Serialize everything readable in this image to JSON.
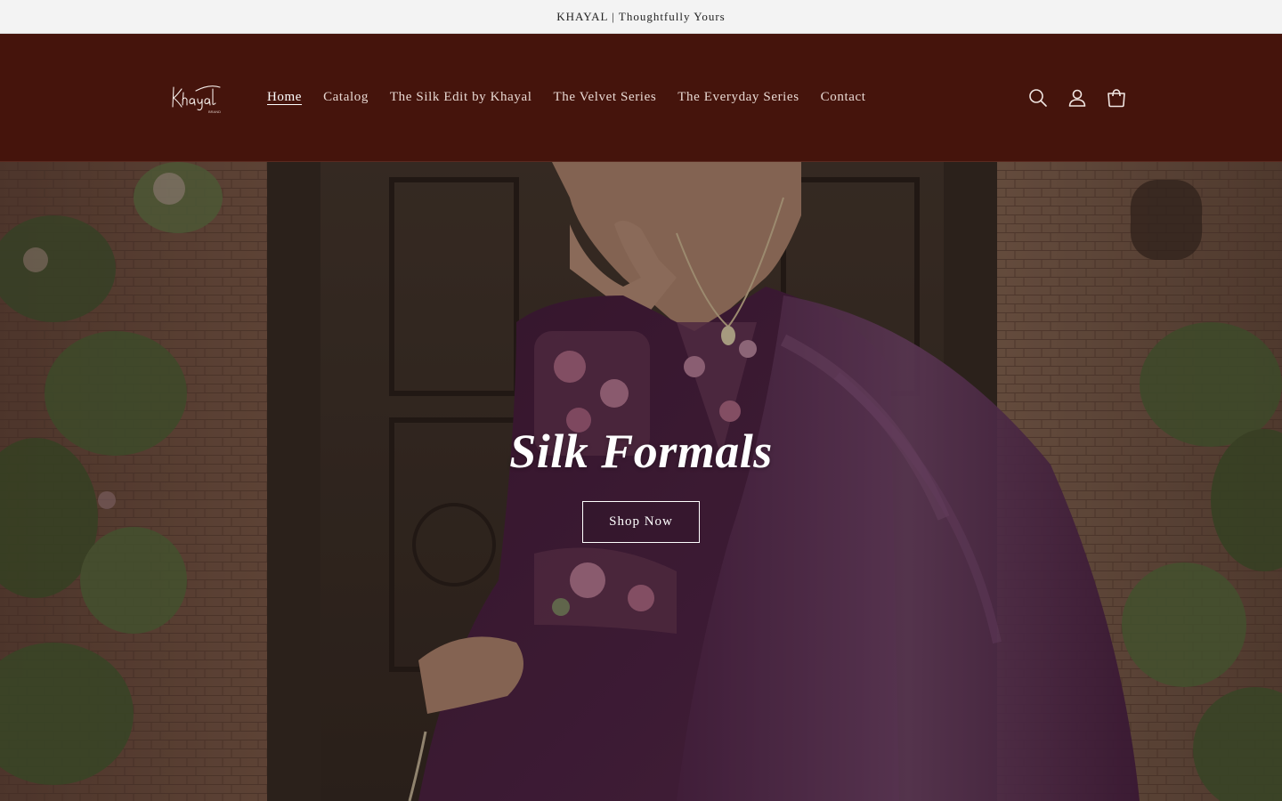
{
  "announcement": {
    "text": "KHAYAL | Thoughtfully Yours"
  },
  "header": {
    "logo_text": "Khayal",
    "nav": [
      {
        "label": "Home",
        "active": true
      },
      {
        "label": "Catalog",
        "active": false
      },
      {
        "label": "The Silk Edit by Khayal",
        "active": false
      },
      {
        "label": "The Velvet Series",
        "active": false
      },
      {
        "label": "The Everyday Series",
        "active": false
      },
      {
        "label": "Contact",
        "active": false
      }
    ],
    "icons": [
      "search-icon",
      "account-icon",
      "cart-icon"
    ]
  },
  "hero": {
    "title": "Silk Formals",
    "button_label": "Shop Now"
  },
  "colors": {
    "announcement_bg": "#f3f3f3",
    "header_bg": "#45140c",
    "nav_text": "#e8d8d2",
    "outfit_plum": "#4a1e3e"
  }
}
